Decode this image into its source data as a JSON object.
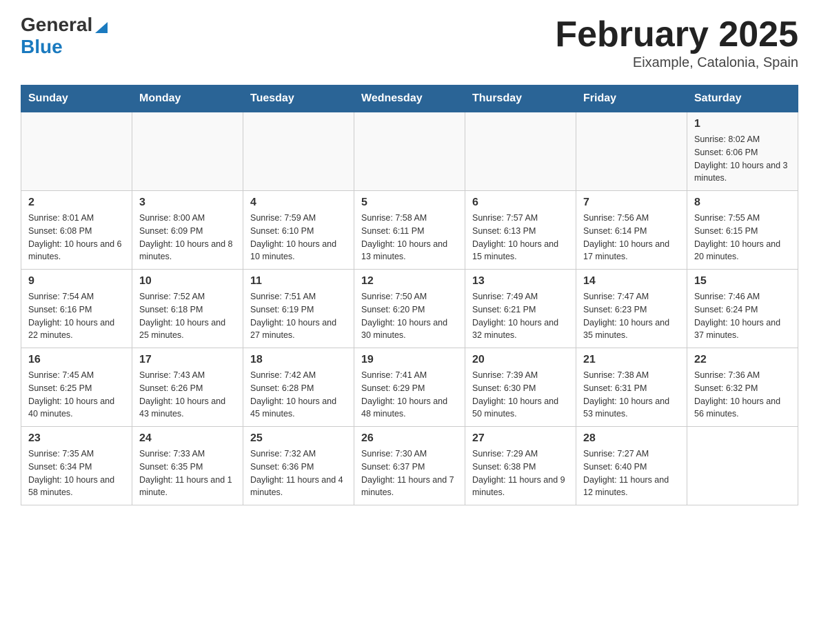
{
  "header": {
    "logo_general": "General",
    "logo_blue": "Blue",
    "title": "February 2025",
    "subtitle": "Eixample, Catalonia, Spain"
  },
  "days_of_week": [
    "Sunday",
    "Monday",
    "Tuesday",
    "Wednesday",
    "Thursday",
    "Friday",
    "Saturday"
  ],
  "weeks": [
    [
      {
        "day": "",
        "info": ""
      },
      {
        "day": "",
        "info": ""
      },
      {
        "day": "",
        "info": ""
      },
      {
        "day": "",
        "info": ""
      },
      {
        "day": "",
        "info": ""
      },
      {
        "day": "",
        "info": ""
      },
      {
        "day": "1",
        "info": "Sunrise: 8:02 AM\nSunset: 6:06 PM\nDaylight: 10 hours and 3 minutes."
      }
    ],
    [
      {
        "day": "2",
        "info": "Sunrise: 8:01 AM\nSunset: 6:08 PM\nDaylight: 10 hours and 6 minutes."
      },
      {
        "day": "3",
        "info": "Sunrise: 8:00 AM\nSunset: 6:09 PM\nDaylight: 10 hours and 8 minutes."
      },
      {
        "day": "4",
        "info": "Sunrise: 7:59 AM\nSunset: 6:10 PM\nDaylight: 10 hours and 10 minutes."
      },
      {
        "day": "5",
        "info": "Sunrise: 7:58 AM\nSunset: 6:11 PM\nDaylight: 10 hours and 13 minutes."
      },
      {
        "day": "6",
        "info": "Sunrise: 7:57 AM\nSunset: 6:13 PM\nDaylight: 10 hours and 15 minutes."
      },
      {
        "day": "7",
        "info": "Sunrise: 7:56 AM\nSunset: 6:14 PM\nDaylight: 10 hours and 17 minutes."
      },
      {
        "day": "8",
        "info": "Sunrise: 7:55 AM\nSunset: 6:15 PM\nDaylight: 10 hours and 20 minutes."
      }
    ],
    [
      {
        "day": "9",
        "info": "Sunrise: 7:54 AM\nSunset: 6:16 PM\nDaylight: 10 hours and 22 minutes."
      },
      {
        "day": "10",
        "info": "Sunrise: 7:52 AM\nSunset: 6:18 PM\nDaylight: 10 hours and 25 minutes."
      },
      {
        "day": "11",
        "info": "Sunrise: 7:51 AM\nSunset: 6:19 PM\nDaylight: 10 hours and 27 minutes."
      },
      {
        "day": "12",
        "info": "Sunrise: 7:50 AM\nSunset: 6:20 PM\nDaylight: 10 hours and 30 minutes."
      },
      {
        "day": "13",
        "info": "Sunrise: 7:49 AM\nSunset: 6:21 PM\nDaylight: 10 hours and 32 minutes."
      },
      {
        "day": "14",
        "info": "Sunrise: 7:47 AM\nSunset: 6:23 PM\nDaylight: 10 hours and 35 minutes."
      },
      {
        "day": "15",
        "info": "Sunrise: 7:46 AM\nSunset: 6:24 PM\nDaylight: 10 hours and 37 minutes."
      }
    ],
    [
      {
        "day": "16",
        "info": "Sunrise: 7:45 AM\nSunset: 6:25 PM\nDaylight: 10 hours and 40 minutes."
      },
      {
        "day": "17",
        "info": "Sunrise: 7:43 AM\nSunset: 6:26 PM\nDaylight: 10 hours and 43 minutes."
      },
      {
        "day": "18",
        "info": "Sunrise: 7:42 AM\nSunset: 6:28 PM\nDaylight: 10 hours and 45 minutes."
      },
      {
        "day": "19",
        "info": "Sunrise: 7:41 AM\nSunset: 6:29 PM\nDaylight: 10 hours and 48 minutes."
      },
      {
        "day": "20",
        "info": "Sunrise: 7:39 AM\nSunset: 6:30 PM\nDaylight: 10 hours and 50 minutes."
      },
      {
        "day": "21",
        "info": "Sunrise: 7:38 AM\nSunset: 6:31 PM\nDaylight: 10 hours and 53 minutes."
      },
      {
        "day": "22",
        "info": "Sunrise: 7:36 AM\nSunset: 6:32 PM\nDaylight: 10 hours and 56 minutes."
      }
    ],
    [
      {
        "day": "23",
        "info": "Sunrise: 7:35 AM\nSunset: 6:34 PM\nDaylight: 10 hours and 58 minutes."
      },
      {
        "day": "24",
        "info": "Sunrise: 7:33 AM\nSunset: 6:35 PM\nDaylight: 11 hours and 1 minute."
      },
      {
        "day": "25",
        "info": "Sunrise: 7:32 AM\nSunset: 6:36 PM\nDaylight: 11 hours and 4 minutes."
      },
      {
        "day": "26",
        "info": "Sunrise: 7:30 AM\nSunset: 6:37 PM\nDaylight: 11 hours and 7 minutes."
      },
      {
        "day": "27",
        "info": "Sunrise: 7:29 AM\nSunset: 6:38 PM\nDaylight: 11 hours and 9 minutes."
      },
      {
        "day": "28",
        "info": "Sunrise: 7:27 AM\nSunset: 6:40 PM\nDaylight: 11 hours and 12 minutes."
      },
      {
        "day": "",
        "info": ""
      }
    ]
  ]
}
